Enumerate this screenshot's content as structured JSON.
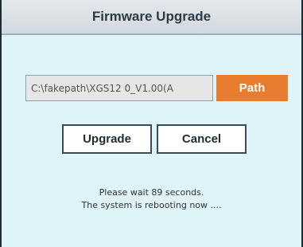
{
  "dialog": {
    "title": "Firmware Upgrade"
  },
  "file": {
    "path_value": "C:\\fakepath\\XGS12 0_V1.00(A",
    "path_button_label": "Path"
  },
  "actions": {
    "upgrade_label": "Upgrade",
    "cancel_label": "Cancel"
  },
  "status": {
    "line1": "Please wait 89 seconds.",
    "line2": "The system is rebooting now ...."
  },
  "colors": {
    "background": "#dff4f8",
    "accent": "#e97d2f",
    "title_bar": "#d9dfe3"
  }
}
